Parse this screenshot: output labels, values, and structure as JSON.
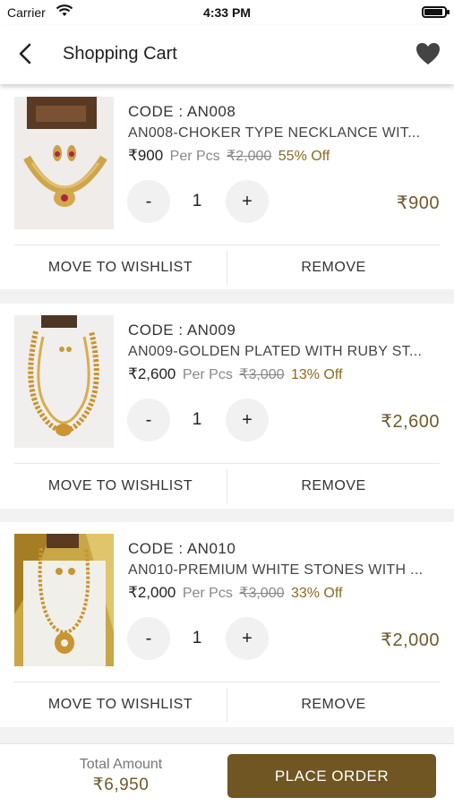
{
  "status_bar": {
    "carrier": "Carrier",
    "time": "4:33 PM"
  },
  "header": {
    "title": "Shopping Cart"
  },
  "cart": {
    "items": [
      {
        "code": "CODE : AN008",
        "name": "AN008-CHOKER TYPE NECKLANCE WIT...",
        "price": "₹900",
        "per": "Per Pcs",
        "mrp": "₹2,000",
        "discount": "55% Off",
        "minus": "-",
        "quantity": "1",
        "plus": "+",
        "total": "₹900",
        "wishlist_label": "MOVE TO WISHLIST",
        "remove_label": "REMOVE"
      },
      {
        "code": "CODE : AN009",
        "name": "AN009-GOLDEN PLATED WITH RUBY ST...",
        "price": "₹2,600",
        "per": "Per Pcs",
        "mrp": "₹3,000",
        "discount": "13% Off",
        "minus": "-",
        "quantity": "1",
        "plus": "+",
        "total": "₹2,600",
        "wishlist_label": "MOVE TO WISHLIST",
        "remove_label": "REMOVE"
      },
      {
        "code": "CODE : AN010",
        "name": "AN010-PREMIUM WHITE STONES WITH ...",
        "price": "₹2,000",
        "per": "Per Pcs",
        "mrp": "₹3,000",
        "discount": "33% Off",
        "minus": "-",
        "quantity": "1",
        "plus": "+",
        "total": "₹2,000",
        "wishlist_label": "MOVE TO WISHLIST",
        "remove_label": "REMOVE"
      }
    ]
  },
  "footer": {
    "total_label": "Total Amount",
    "total_value": "₹6,950",
    "place_order_label": "PLACE ORDER"
  },
  "colors": {
    "brand": "#6f5622",
    "price_accent": "#6e5a2a",
    "discount": "#8a6a1e"
  },
  "icons": [
    "wifi-icon",
    "battery-icon",
    "back-arrow-icon",
    "heart-icon"
  ]
}
